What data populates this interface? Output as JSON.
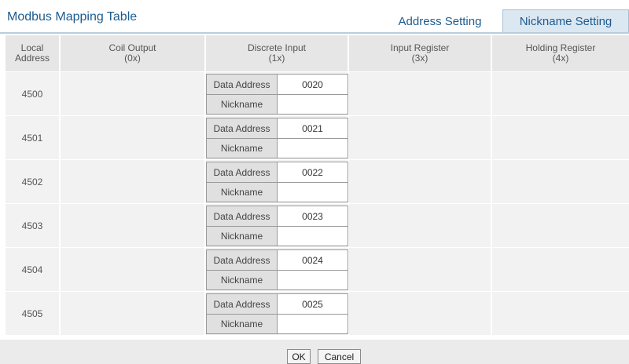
{
  "header": {
    "title": "Modbus Mapping Table",
    "tabs": [
      {
        "label": "Address Setting",
        "active": false
      },
      {
        "label": "Nickname Setting",
        "active": true
      }
    ]
  },
  "columns": {
    "local": {
      "line1": "Local",
      "line2": "Address"
    },
    "coil": {
      "line1": "Coil Output",
      "line2": "(0x)"
    },
    "discrete": {
      "line1": "Discrete Input",
      "line2": "(1x)"
    },
    "input": {
      "line1": "Input Register",
      "line2": "(3x)"
    },
    "holding": {
      "line1": "Holding Register",
      "line2": "(4x)"
    }
  },
  "labels": {
    "data_address": "Data Address",
    "nickname": "Nickname"
  },
  "rows": [
    {
      "local": "4500",
      "data_address": "0020",
      "nickname": ""
    },
    {
      "local": "4501",
      "data_address": "0021",
      "nickname": ""
    },
    {
      "local": "4502",
      "data_address": "0022",
      "nickname": ""
    },
    {
      "local": "4503",
      "data_address": "0023",
      "nickname": ""
    },
    {
      "local": "4504",
      "data_address": "0024",
      "nickname": ""
    },
    {
      "local": "4505",
      "data_address": "0025",
      "nickname": ""
    }
  ],
  "footer": {
    "ok_label": "OK",
    "cancel_label": "Cancel"
  },
  "colors": {
    "title": "#1d5b8f",
    "active_tab_bg": "#dbe7f1",
    "header_bg": "#e6e6e6",
    "row_bg": "#f2f2f2"
  }
}
